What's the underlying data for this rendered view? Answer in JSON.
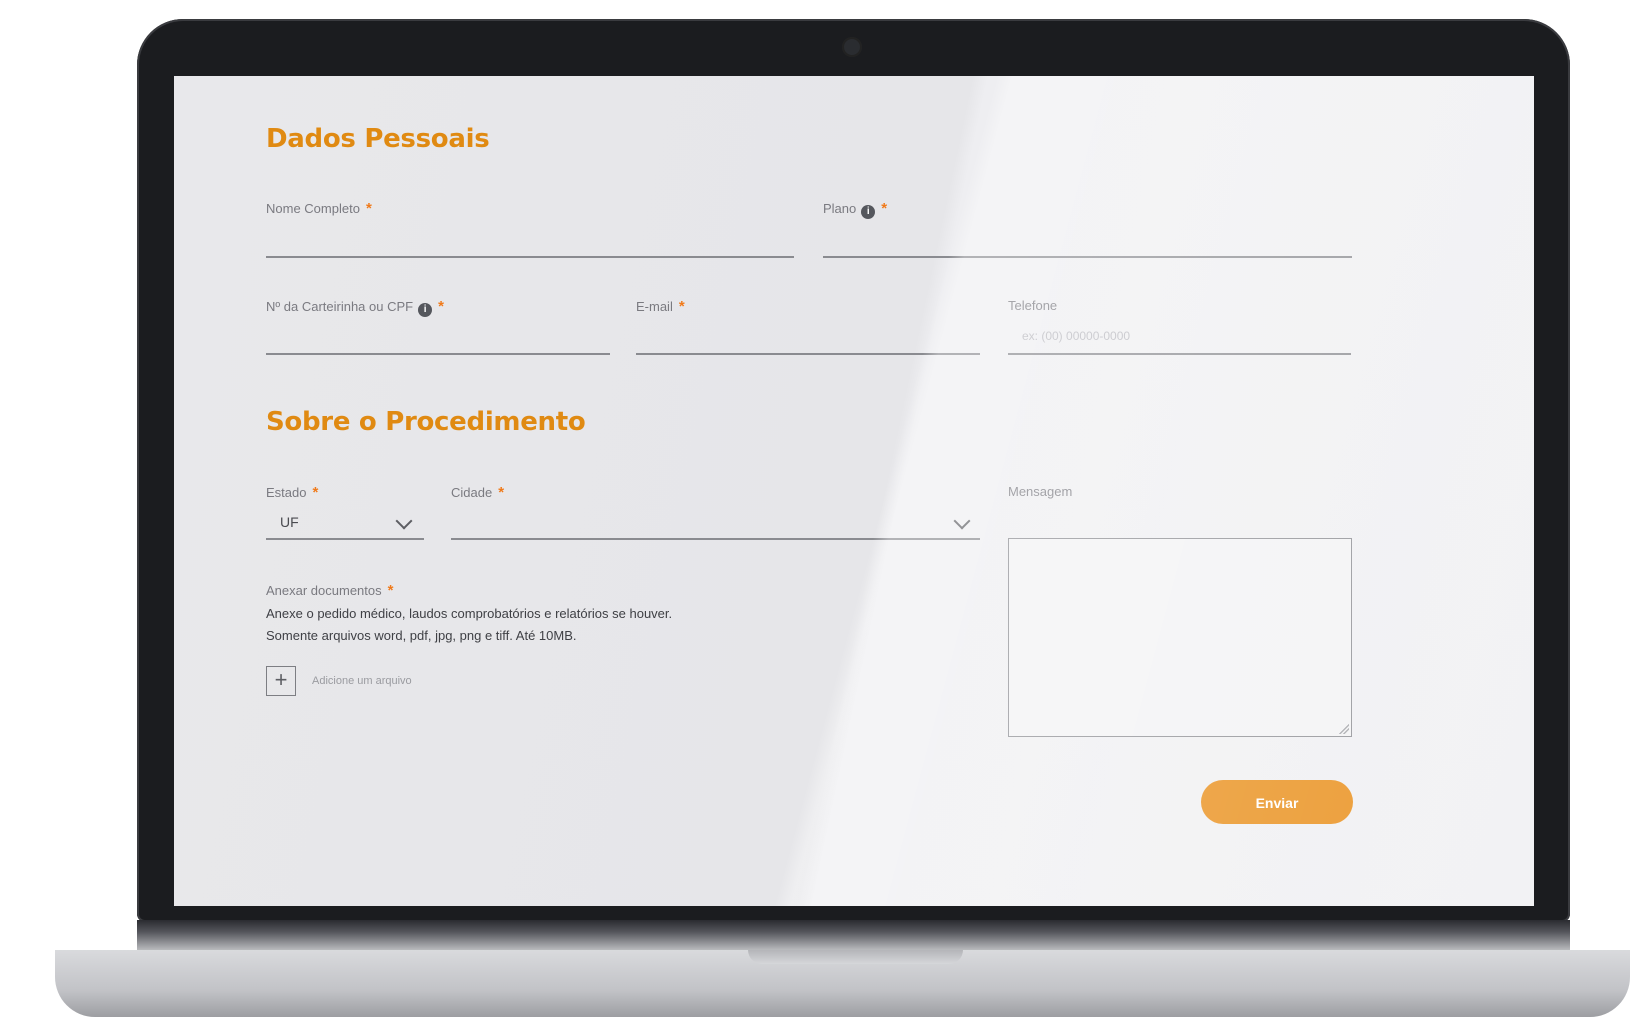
{
  "personal": {
    "title": "Dados Pessoais",
    "full_name_label": "Nome Completo",
    "plan_label": "Plano",
    "card_or_cpf_label": "Nº da Carteirinha ou CPF",
    "email_label": "E-mail",
    "phone_label": "Telefone",
    "phone_placeholder": "ex: (00) 00000-0000"
  },
  "procedure": {
    "title": "Sobre o Procedimento",
    "state_label": "Estado",
    "state_value": "UF",
    "city_label": "Cidade",
    "message_label": "Mensagem",
    "attach_label": "Anexar documentos",
    "attach_help_line1": "Anexe o pedido médico, laudos comprobatórios e relatórios se houver.",
    "attach_help_line2": "Somente arquivos word, pdf, jpg, png e tiff. Até 10MB.",
    "add_file_label": "Adicione um arquivo",
    "plus": "+"
  },
  "required_mark": "*",
  "info_mark": "i",
  "submit_label": "Enviar",
  "colors": {
    "accent": "#e88a10",
    "title": "#e08a12",
    "required": "#f07a1a"
  },
  "icons": [
    "info-icon",
    "chevron-down-icon",
    "plus-icon",
    "resize-handle-icon"
  ]
}
